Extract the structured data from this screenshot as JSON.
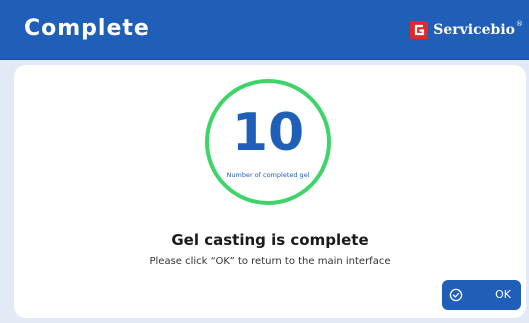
{
  "header": {
    "title": "Complete",
    "brand_name": "Servicebio",
    "brand_reg": "®"
  },
  "progress": {
    "count": "10",
    "count_label": "Number of completed gel"
  },
  "message": {
    "title": "Gel casting is complete",
    "subtitle": "Please click “OK” to return to the main interface"
  },
  "actions": {
    "ok_label": "OK"
  },
  "colors": {
    "header_bg": "#1f5fb8",
    "ring": "#3ed46a",
    "brand_mark": "#e02a2a",
    "accent": "#1f5fb8"
  },
  "icons": {
    "ok": "check-circle-icon",
    "brand": "servicebio-logo-icon"
  }
}
